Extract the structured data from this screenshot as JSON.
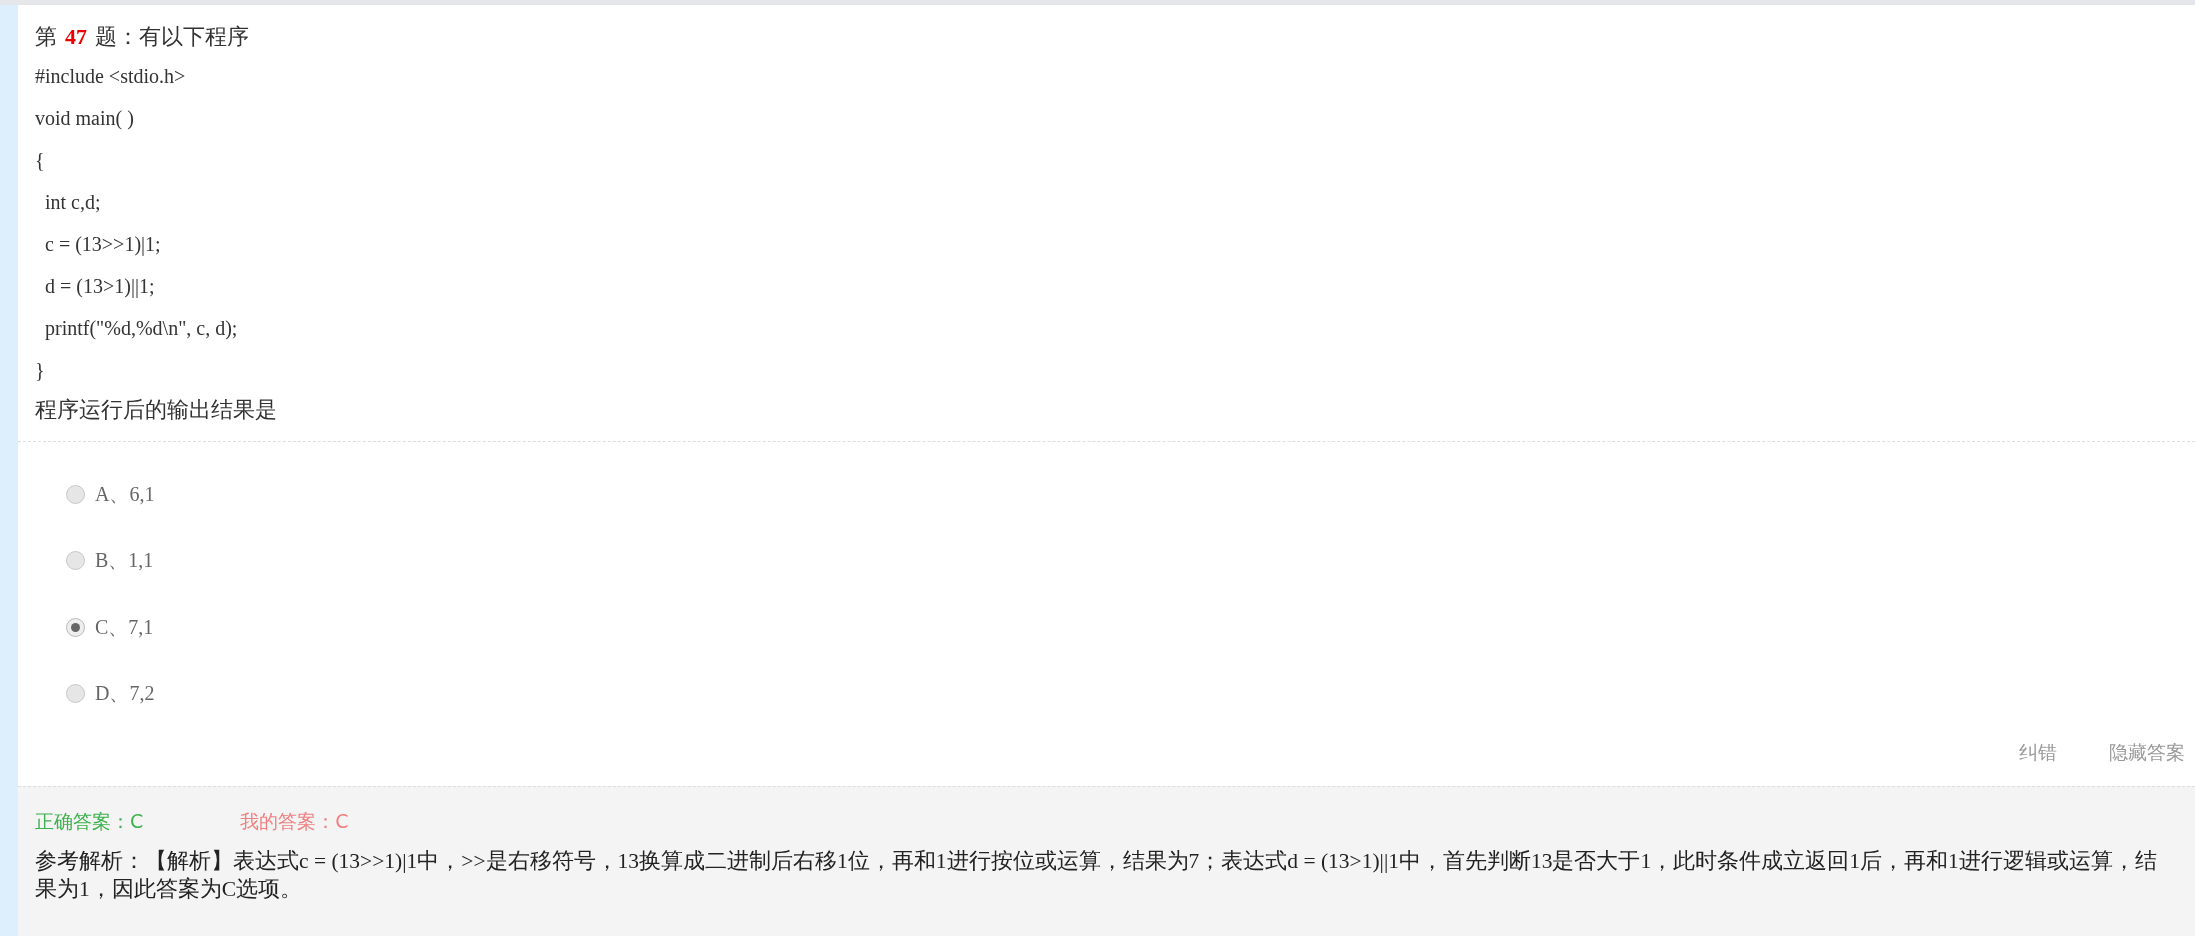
{
  "question": {
    "prefix": "第",
    "number": "47",
    "suffix": "题：有以下程序",
    "code_lines": [
      "#include <stdio.h>",
      "void main( )",
      "{",
      "  int c,d;",
      "  c = (13>>1)|1;",
      "  d = (13>1)||1;",
      "  printf(\"%d,%d\\n\", c, d);",
      "}"
    ],
    "prompt": "程序运行后的输出结果是"
  },
  "options": [
    {
      "label": "A、6,1",
      "selected": false
    },
    {
      "label": "B、1,1",
      "selected": false
    },
    {
      "label": "C、7,1",
      "selected": true
    },
    {
      "label": "D、7,2",
      "selected": false
    }
  ],
  "actions": [
    "纠错",
    "隐藏答案"
  ],
  "answers": {
    "correct": "正确答案：C",
    "mine": "我的答案：C"
  },
  "explanation": "参考解析：【解析】表达式c = (13>>1)|1中，>>是右移符号，13换算成二进制后右移1位，再和1进行按位或运算，结果为7；表达式d = (13>1)||1中，首先判断13是否大于1，此时条件成立返回1后，再和1进行逻辑或运算，结果为1，因此答案为C选项。"
}
